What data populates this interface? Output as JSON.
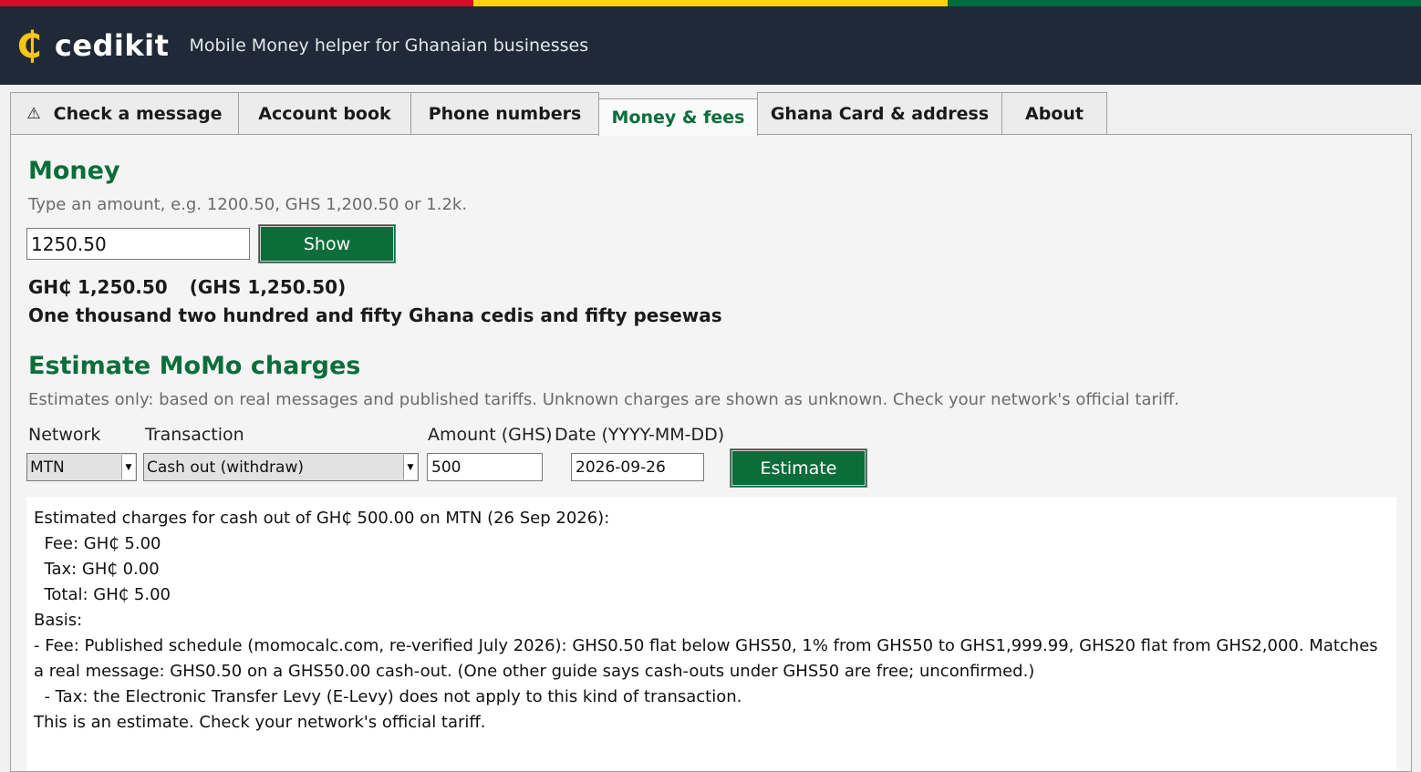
{
  "colors": {
    "flag_red": "#ce1126",
    "flag_gold": "#fcd116",
    "flag_green": "#006b3f",
    "header_bg": "#1f2937",
    "accent_green": "#0b6e3a",
    "logo_gold": "#f5c518"
  },
  "header": {
    "logo_mark": "₵",
    "logo_text": "cedikit",
    "tagline": "Mobile Money helper for Ghanaian businesses"
  },
  "tabs": [
    {
      "label": "Check a message",
      "icon": "warning-icon",
      "icon_glyph": "⚠"
    },
    {
      "label": "Account book"
    },
    {
      "label": "Phone numbers"
    },
    {
      "label": "Money & fees",
      "active": true
    },
    {
      "label": "Ghana Card & address"
    },
    {
      "label": "About"
    }
  ],
  "money": {
    "title": "Money",
    "hint": "Type an amount, e.g. 1200.50, GHS 1,200.50 or 1.2k.",
    "input_value": "1250.50",
    "show_label": "Show",
    "formatted": "GH₵ 1,250.50",
    "formatted_code": "(GHS 1,250.50)",
    "words": "One thousand two hundred and fifty Ghana cedis and fifty pesewas"
  },
  "estimate": {
    "title": "Estimate MoMo charges",
    "hint": "Estimates only: based on real messages and published tariffs. Unknown charges are shown as unknown. Check your network's official tariff.",
    "network_label": "Network",
    "network_value": "MTN",
    "transaction_label": "Transaction",
    "transaction_value": "Cash out (withdraw)",
    "amount_label": "Amount (GHS)",
    "amount_value": "500",
    "date_label": "Date (YYYY-MM-DD)",
    "date_value": "2026-09-26",
    "button_label": "Estimate"
  },
  "output": {
    "summary": "Estimated charges for cash out of GH₵ 500.00 on MTN (26 Sep 2026):",
    "fee": "  Fee: GH₵ 5.00",
    "tax": "  Tax: GH₵ 0.00",
    "total": "  Total: GH₵ 5.00",
    "basis_label": "Basis:",
    "basis_fee": "  - Fee: Published schedule (momocalc.com, re-verified July 2026): GHS0.50 flat below GHS50, 1% from GHS50 to GHS1,999.99, GHS20 flat from GHS2,000. Matches a real message: GHS0.50 on a GHS50.00 cash-out. (One other guide says cash-outs under GHS50 are free; unconfirmed.)",
    "basis_tax": "  - Tax: the Electronic Transfer Levy (E-Levy) does not apply to this kind of transaction.",
    "disclaimer": "This is an estimate. Check your network's official tariff."
  }
}
